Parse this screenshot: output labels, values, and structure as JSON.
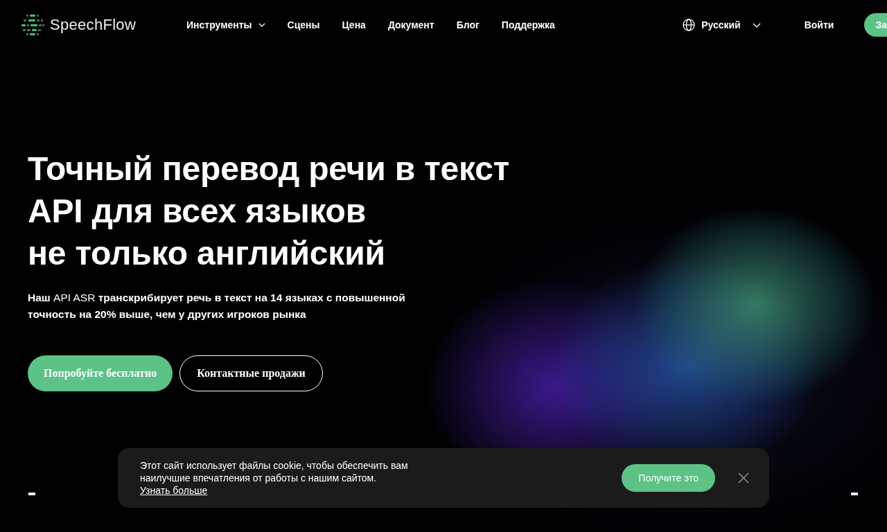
{
  "header": {
    "logo": {
      "text": "SpeechFlow"
    },
    "nav": [
      {
        "label": "Инструменты",
        "kind": "dropdown"
      },
      {
        "label": "Сцены",
        "kind": "link"
      },
      {
        "label": "Цена",
        "kind": "link"
      },
      {
        "label": "Документ",
        "kind": "link"
      },
      {
        "label": "Блог",
        "kind": "link"
      },
      {
        "label": "Поддержка",
        "kind": "link"
      }
    ],
    "language": {
      "label": "Русский"
    },
    "login": "Войти",
    "signup": "За"
  },
  "hero": {
    "title_lines": [
      "Точный перевод речи в текст",
      "API для всех языков",
      "не только английский"
    ],
    "subtitle": "**Наш** API ASR **транскрибирует речь в текст на 14 языках с повышенной точность на 20% выше, чем у других игроков рынка**",
    "buttons": [
      {
        "label": "Попробуйте бесплатно",
        "kind": "primary"
      },
      {
        "label": "Контактные продажи",
        "kind": "outline"
      }
    ]
  },
  "cookie_banner": {
    "text": "Этот сайт использует файлы cookie, чтобы обеспечить вам наилучшие впечатления от работы с нашим сайтом.",
    "link": "Узнать больше",
    "accept": "Получите это"
  }
}
